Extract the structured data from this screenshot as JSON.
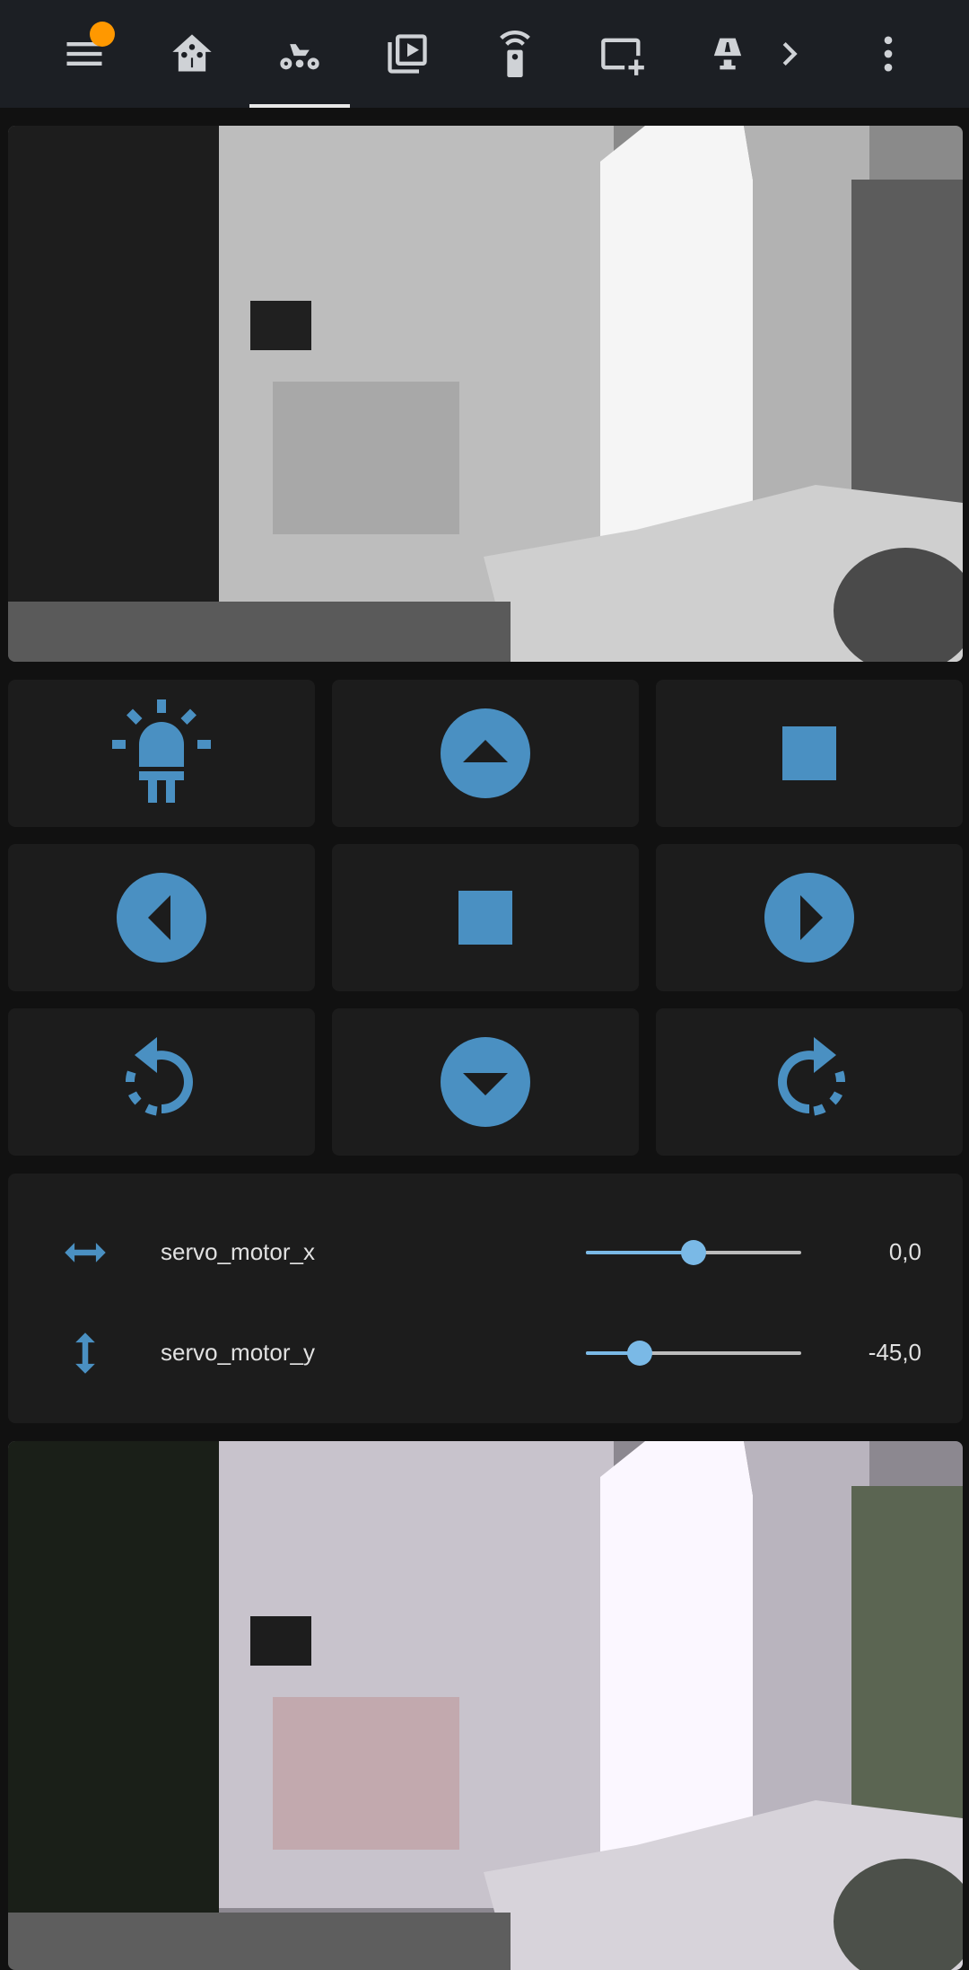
{
  "toolbar": {
    "tabs": [
      {
        "icon": "menu-icon",
        "active": false
      },
      {
        "icon": "home-assistant-icon",
        "active": false
      },
      {
        "icon": "robot-vehicle-icon",
        "active": true
      },
      {
        "icon": "media-collection-icon",
        "active": false
      },
      {
        "icon": "remote-icon",
        "active": false
      },
      {
        "icon": "card-add-icon",
        "active": false
      },
      {
        "icon": "lamp-icon",
        "active": false
      }
    ],
    "overflow_icon": "chevron-right-icon",
    "more_icon": "dots-vertical-icon",
    "notification_color": "#ff9800"
  },
  "controls": {
    "accent": "#4a90c2",
    "buttons": [
      [
        "led-icon",
        "arrow-up-circle-icon",
        "stop-icon"
      ],
      [
        "arrow-left-circle-icon",
        "stop-icon",
        "arrow-right-circle-icon"
      ],
      [
        "rotate-left-icon",
        "arrow-down-circle-icon",
        "rotate-right-icon"
      ]
    ]
  },
  "sliders": [
    {
      "name": "servo_motor_x",
      "value": "0,0",
      "numeric": 0,
      "min": -90,
      "max": 90,
      "icon": "arrow-left-right-icon"
    },
    {
      "name": "servo_motor_y",
      "value": "-45,0",
      "numeric": -45,
      "min": -90,
      "max": 90,
      "icon": "arrow-up-down-icon"
    }
  ]
}
